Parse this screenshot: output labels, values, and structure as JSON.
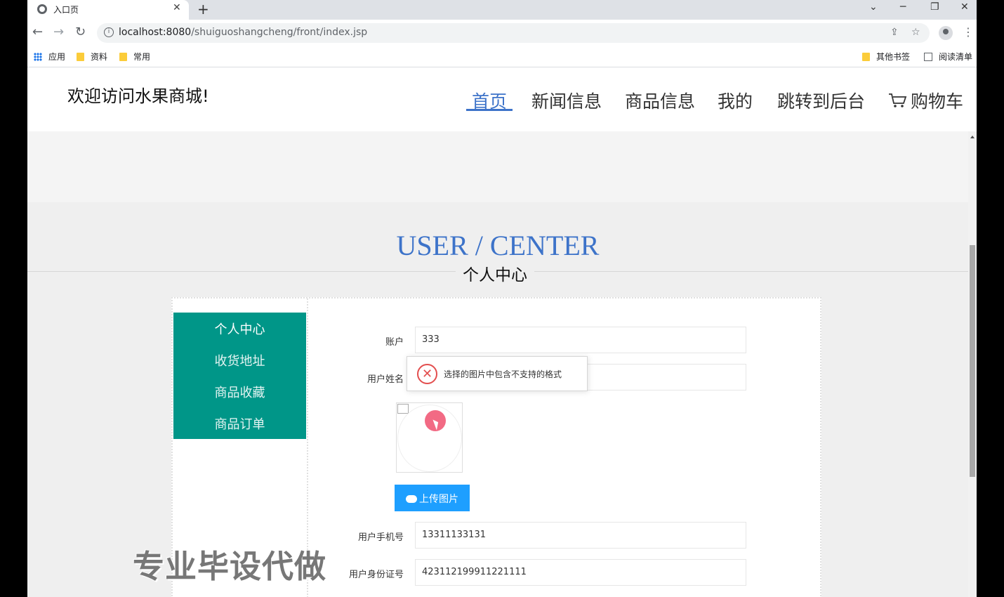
{
  "browser": {
    "tab_title": "入口页",
    "url_host": "localhost:8080",
    "url_path": "/shuiguoshangcheng/front/index.jsp",
    "bookmarks": {
      "apps": "应用",
      "folder1": "资料",
      "folder2": "常用",
      "other": "其他书签",
      "reading_list": "阅读清单"
    }
  },
  "site": {
    "title": "欢迎访问水果商城!",
    "nav": {
      "home": "首页",
      "news": "新闻信息",
      "products": "商品信息",
      "mine": "我的",
      "admin": "跳转到后台",
      "cart": "购物车"
    }
  },
  "section": {
    "title_en": "USER / CENTER",
    "title_cn": "个人中心"
  },
  "sidebar": {
    "items": [
      {
        "label": "个人中心"
      },
      {
        "label": "收货地址"
      },
      {
        "label": "商品收藏"
      },
      {
        "label": "商品订单"
      }
    ]
  },
  "form": {
    "account_label": "账户",
    "account_value": "333",
    "name_label": "用户姓名",
    "name_value": "",
    "upload_label": "上传图片",
    "phone_label": "用户手机号",
    "phone_value": "13311133131",
    "idcard_label": "用户身份证号",
    "idcard_value": "423112199911221111"
  },
  "toast": {
    "message": "选择的图片中包含不支持的格式"
  },
  "watermark": "专业毕设代做",
  "colors": {
    "accent": "#3d73c9",
    "sidebar": "#009688",
    "upload_button": "#1e9fff",
    "error": "#e34e4e"
  }
}
